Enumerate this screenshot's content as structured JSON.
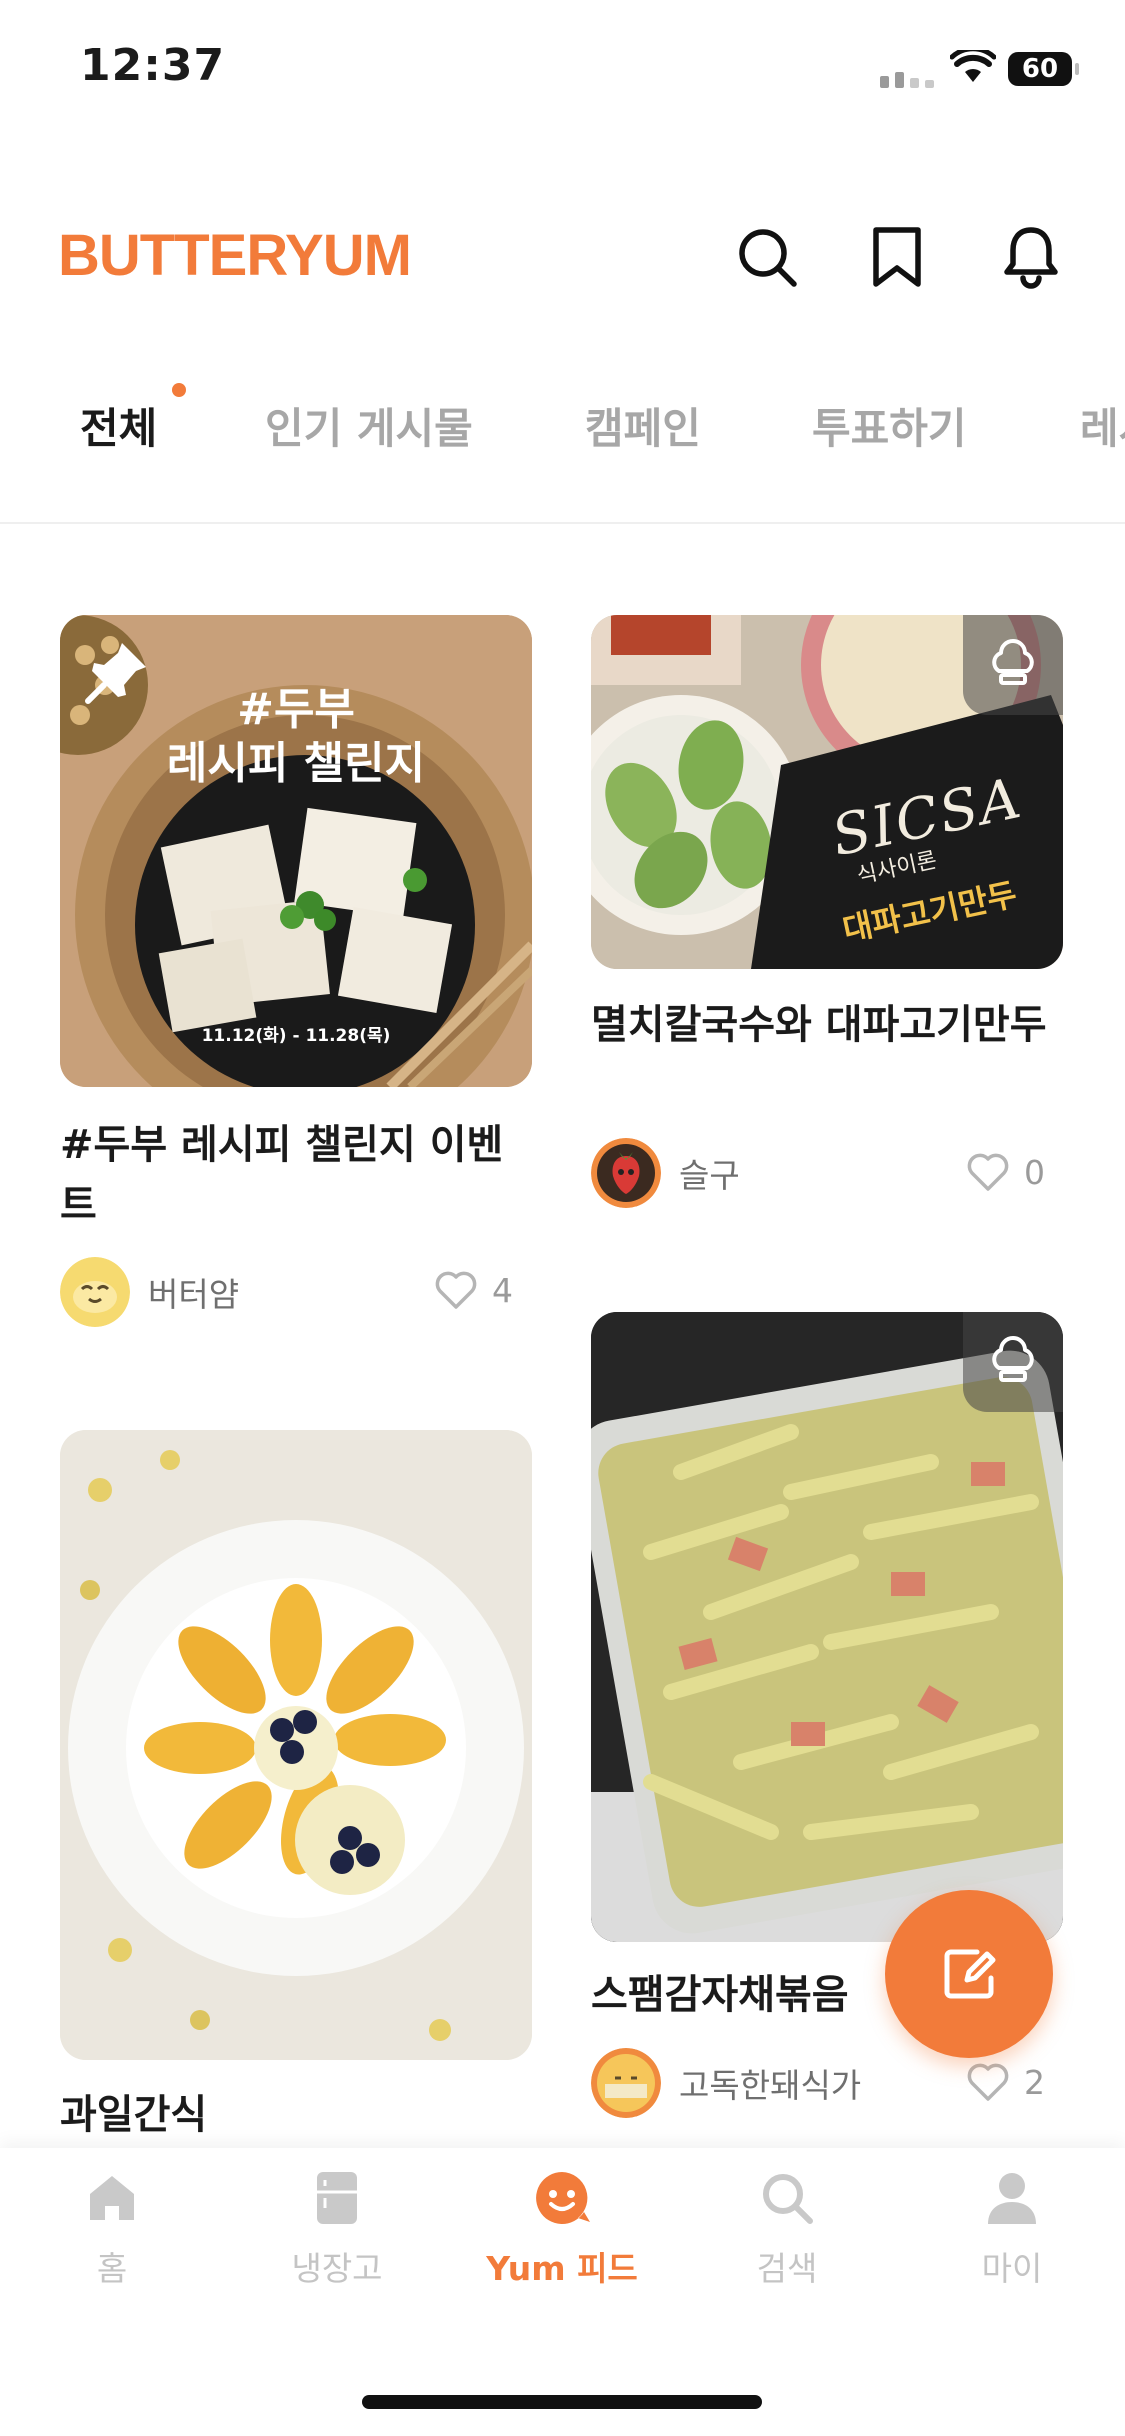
{
  "status_bar": {
    "time": "12:37",
    "battery": "60"
  },
  "header": {
    "logo": "BUTTERYUM",
    "icons": [
      "search-icon",
      "bookmark-icon",
      "bell-icon"
    ]
  },
  "tabs": [
    {
      "label": "전체",
      "active": true,
      "has_dot": true
    },
    {
      "label": "인기 게시물"
    },
    {
      "label": "캠페인"
    },
    {
      "label": "투표하기"
    },
    {
      "label": "레시"
    }
  ],
  "feed": {
    "posts": [
      {
        "image_text": {
          "hashtag": "#두부",
          "subtitle": "레시피 챌린지",
          "dates": "11.12(화) - 11.28(목)"
        },
        "title": "#두부 레시피 챌린지 이벤트",
        "author": "버터얌",
        "likes": "4",
        "pinned": true
      },
      {
        "title": "멸치칼국수와 대파고기만두",
        "author": "슬구",
        "likes": "0",
        "image_text": {
          "package_brand": "SICSA",
          "package_kor": "식사이론",
          "package_name": "대파고기만두"
        }
      },
      {
        "title": "과일간식",
        "author": "",
        "likes": ""
      },
      {
        "title": "스팸감자채볶음",
        "author": "고독한돼식가",
        "likes": "2"
      }
    ]
  },
  "colors": {
    "accent": "#f27b3a",
    "text": "#1b1b1b",
    "muted": "#a7a7a7"
  },
  "bottom_nav": [
    {
      "label": "홈",
      "icon": "home-icon"
    },
    {
      "label": "냉장고",
      "icon": "fridge-icon"
    },
    {
      "label": "Yum 피드",
      "icon": "yum-feed-icon",
      "active": true
    },
    {
      "label": "검색",
      "icon": "search-icon"
    },
    {
      "label": "마이",
      "icon": "profile-icon"
    }
  ]
}
